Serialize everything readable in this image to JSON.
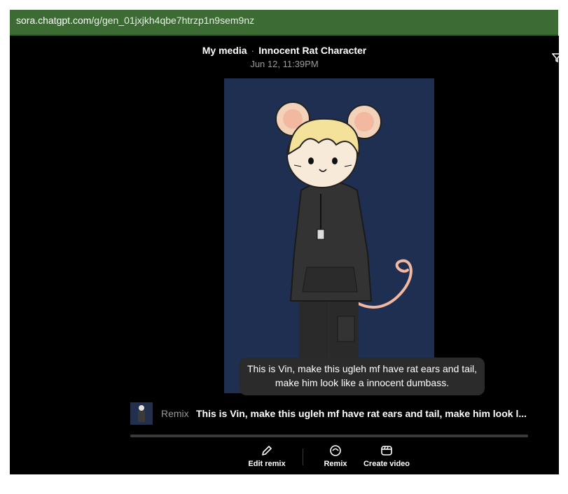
{
  "browser": {
    "url_host": "sora.chatgpt.com",
    "url_path": "/g/gen_01jxjkh4qbe7htrzp1n9sem9nz"
  },
  "header": {
    "breadcrumb_parent": "My media",
    "separator": "·",
    "title": "Innocent Rat Character",
    "date": "Jun 12, 11:39PM"
  },
  "tooltip": {
    "text": "This is Vin, make this ugleh mf have rat ears and tail, make him look like a innocent dumbass."
  },
  "remix": {
    "label": "Remix",
    "prompt": "This is Vin, make this ugleh mf have rat ears and tail, make him look l..."
  },
  "actions": {
    "edit_remix": "Edit remix",
    "remix": "Remix",
    "create_video": "Create video"
  },
  "colors": {
    "urlbar": "#3c6b34",
    "background": "#000000",
    "image_bg": "#1f2f52"
  }
}
